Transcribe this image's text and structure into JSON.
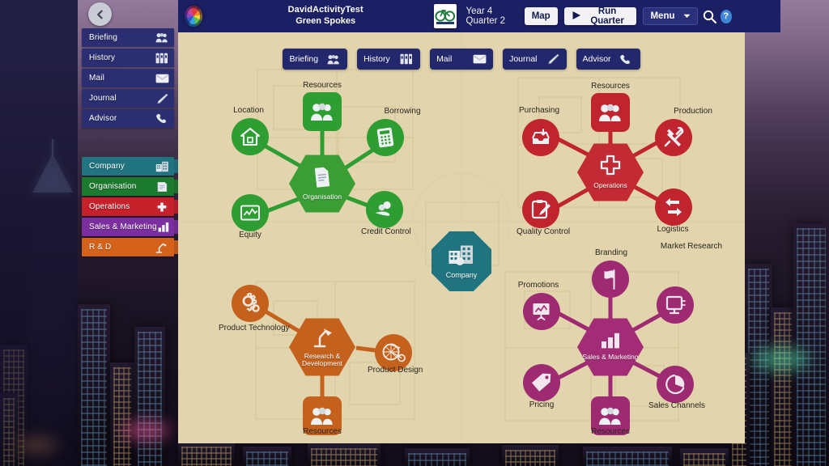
{
  "window": {
    "back_button": "back-button"
  },
  "header": {
    "logo": "spectrum-wheel-logo",
    "title_line1": "DavidActivityTest",
    "title_line2": "Green Spokes",
    "company_logo": "green-spokes-bicycle-logo",
    "period": "Year 4 Quarter 2",
    "map_label": "Map",
    "run_quarter_label": "Run Quarter",
    "menu_label": "Menu",
    "search_icon": "search-icon",
    "help_label": "?"
  },
  "sidebar": {
    "nav_items": [
      {
        "label": "Briefing",
        "icon": "people-icon"
      },
      {
        "label": "History",
        "icon": "binders-icon"
      },
      {
        "label": "Mail",
        "icon": "envelope-icon"
      },
      {
        "label": "Journal",
        "icon": "pencil-icon"
      },
      {
        "label": "Advisor",
        "icon": "phone-icon"
      }
    ],
    "section_items": [
      {
        "label": "Company",
        "icon": "buildings-icon",
        "color": "#1f7480"
      },
      {
        "label": "Organisation",
        "icon": "document-icon",
        "color": "#1c7a2e"
      },
      {
        "label": "Operations",
        "icon": "cross-icon",
        "color": "#c6202a"
      },
      {
        "label": "Sales & Marketing",
        "icon": "barchart-icon",
        "color": "#7b2f9e"
      },
      {
        "label": "R & D",
        "icon": "desklamp-icon",
        "color": "#d4621a"
      }
    ]
  },
  "tabs": [
    {
      "label": "Briefing",
      "icon": "people-icon"
    },
    {
      "label": "History",
      "icon": "binders-icon"
    },
    {
      "label": "Mail",
      "icon": "envelope-icon"
    },
    {
      "label": "Journal",
      "icon": "pencil-icon"
    },
    {
      "label": "Advisor",
      "icon": "phone-icon"
    }
  ],
  "map": {
    "center": {
      "label": "Company",
      "icon": "buildings-icon",
      "color": "#1f7480"
    },
    "clusters": [
      {
        "id": "organisation",
        "hub_label": "Organisation",
        "hub_icon": "document-icon",
        "color": "#2f9e32",
        "hub_color": "#3a9e35",
        "nodes": [
          {
            "label": "Resources",
            "icon": "people-icon",
            "shape": "square"
          },
          {
            "label": "Location",
            "icon": "house-icon",
            "shape": "circle"
          },
          {
            "label": "Borrowing",
            "icon": "calculator-icon",
            "shape": "circle"
          },
          {
            "label": "Equity",
            "icon": "linechart-icon",
            "shape": "circle"
          },
          {
            "label": "Credit Control",
            "icon": "handcoins-icon",
            "shape": "circle"
          }
        ]
      },
      {
        "id": "operations",
        "hub_label": "Operations",
        "hub_icon": "cross-icon",
        "color": "#c0252f",
        "hub_color": "#c22b33",
        "nodes": [
          {
            "label": "Resources",
            "icon": "people-icon",
            "shape": "square"
          },
          {
            "label": "Purchasing",
            "icon": "inbox-icon",
            "shape": "circle"
          },
          {
            "label": "Production",
            "icon": "tools-icon",
            "shape": "circle"
          },
          {
            "label": "Quality Control",
            "icon": "clipboard-icon",
            "shape": "circle"
          },
          {
            "label": "Logistics",
            "icon": "exchange-icon",
            "shape": "circle"
          }
        ]
      },
      {
        "id": "rnd",
        "hub_label": "Research & Development",
        "hub_icon": "desklamp-icon",
        "color": "#c4621d",
        "hub_color": "#c4621d",
        "nodes": [
          {
            "label": "Product Technology",
            "icon": "gears-icon",
            "shape": "circle"
          },
          {
            "label": "Product Design",
            "icon": "pennyfarthing-icon",
            "shape": "circle"
          },
          {
            "label": "Resources",
            "icon": "people-icon",
            "shape": "square"
          }
        ]
      },
      {
        "id": "sales",
        "hub_label": "Sales & Marketing",
        "hub_icon": "barchart-icon",
        "color": "#9e2a72",
        "hub_color": "#a32c77",
        "nodes": [
          {
            "label": "Branding",
            "icon": "flag-icon",
            "shape": "circle"
          },
          {
            "label": "Market Research",
            "icon": "monitor-icon",
            "shape": "circle"
          },
          {
            "label": "Promotions",
            "icon": "presentation-icon",
            "shape": "circle"
          },
          {
            "label": "Pricing",
            "icon": "pricetag-icon",
            "shape": "circle"
          },
          {
            "label": "Sales Channels",
            "icon": "piechart-icon",
            "shape": "circle"
          },
          {
            "label": "Resources",
            "icon": "people-icon",
            "shape": "square"
          }
        ]
      }
    ]
  },
  "colors": {
    "panel_bg": "#e2d5ad",
    "header_bg": "#1b1f63",
    "nav_bg": "#2b2f72",
    "teal": "#1f7480",
    "green": "#2f9e32",
    "red": "#c0252f",
    "orange": "#c4621d",
    "purple": "#9e2a72"
  }
}
